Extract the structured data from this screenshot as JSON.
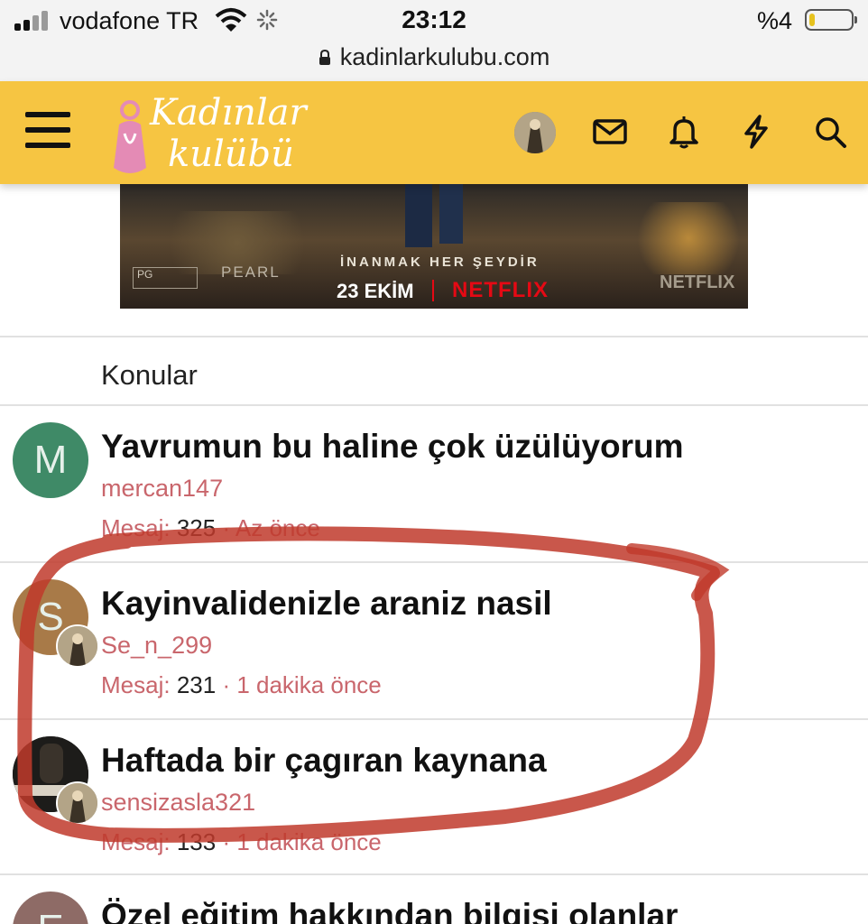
{
  "status_bar": {
    "carrier": "vodafone TR",
    "time": "23:12",
    "battery": "%4"
  },
  "url_bar": {
    "url": "kadinlarkulubu.com"
  },
  "header": {
    "logo_line1": "Kadınlar",
    "logo_line2": "kulübü",
    "brand_color": "#f6c542",
    "icons": [
      "menu-icon",
      "avatar",
      "mail-icon",
      "bell-icon",
      "lightning-icon",
      "search-icon"
    ]
  },
  "ad": {
    "tagline": "İNANMAK HER ŞEYDİR",
    "date": "23 EKİM",
    "brand": "NETFLIX",
    "brand_small": "NETFLIX",
    "studio": "PEARL",
    "rating": "PG"
  },
  "section": {
    "title": "Konular"
  },
  "threads": [
    {
      "title": "Yavrumun bu haline çok üzülüyorum",
      "user": "mercan147",
      "avatar_letter": "M",
      "avatar_color": "#3f8a67",
      "meta_label": "Mesaj:",
      "count": "325",
      "time": "· Az önce"
    },
    {
      "title": "Kayinvalidenizle araniz nasil",
      "user": "Se_n_299",
      "avatar_letter": "S",
      "avatar_color": "#a87a48",
      "meta_label": "Mesaj:",
      "count": "231",
      "time": "· 1 dakika önce"
    },
    {
      "title": "Haftada bir çagıran kaynana",
      "user": "sensizasla321",
      "avatar_letter": "",
      "avatar_color": "#222222",
      "meta_label": "Mesaj:",
      "count": "133",
      "time": "· 1 dakika önce"
    },
    {
      "title": "Özel eğitim hakkından bilgisi olanlar",
      "user": "",
      "avatar_letter": "E",
      "avatar_color": "#8e6b66",
      "meta_label": "",
      "count": "",
      "time": ""
    }
  ],
  "colors": {
    "link": "#c9666c",
    "annotation": "#c0392b"
  }
}
